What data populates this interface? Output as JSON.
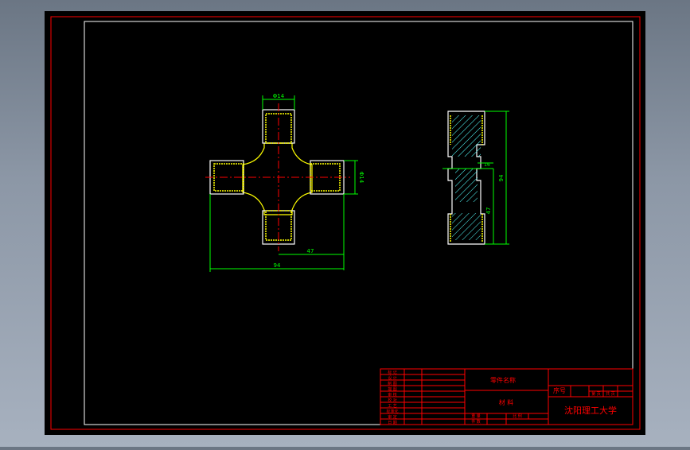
{
  "colors": {
    "window_bg": "#000000",
    "border_red": "#ff0000",
    "frame_white": "#ffffff",
    "part_yellow": "#ffff00",
    "dim_green": "#00ff00",
    "hatch_cyan": "#55ffff",
    "center_red": "#ff0000",
    "title_text": "#ff0000"
  },
  "drawing": {
    "dim_top_width": "Φ14",
    "dim_right_height": "Φ14",
    "dim_arm_length": "47",
    "dim_overall_length": "94",
    "dim_side_neck": "16",
    "dim_side_total": "94",
    "dim_side_half": "47"
  },
  "title_block": {
    "part_name_label": "零件名称",
    "material_label": "材  料",
    "seq_label": "序号",
    "school_name": "沈阳理工大学",
    "left_rows": [
      "标 记",
      "设 计",
      "制 图",
      "描 图",
      "审 核",
      "校 对",
      "工 艺",
      "标准化",
      "审 定",
      "日 期"
    ],
    "weight_label": "重 量",
    "scale_label": "比 例",
    "count_label": "件 数",
    "ratio_label": "比 例",
    "sheet_labels": [
      "第 页",
      "共 页"
    ]
  }
}
